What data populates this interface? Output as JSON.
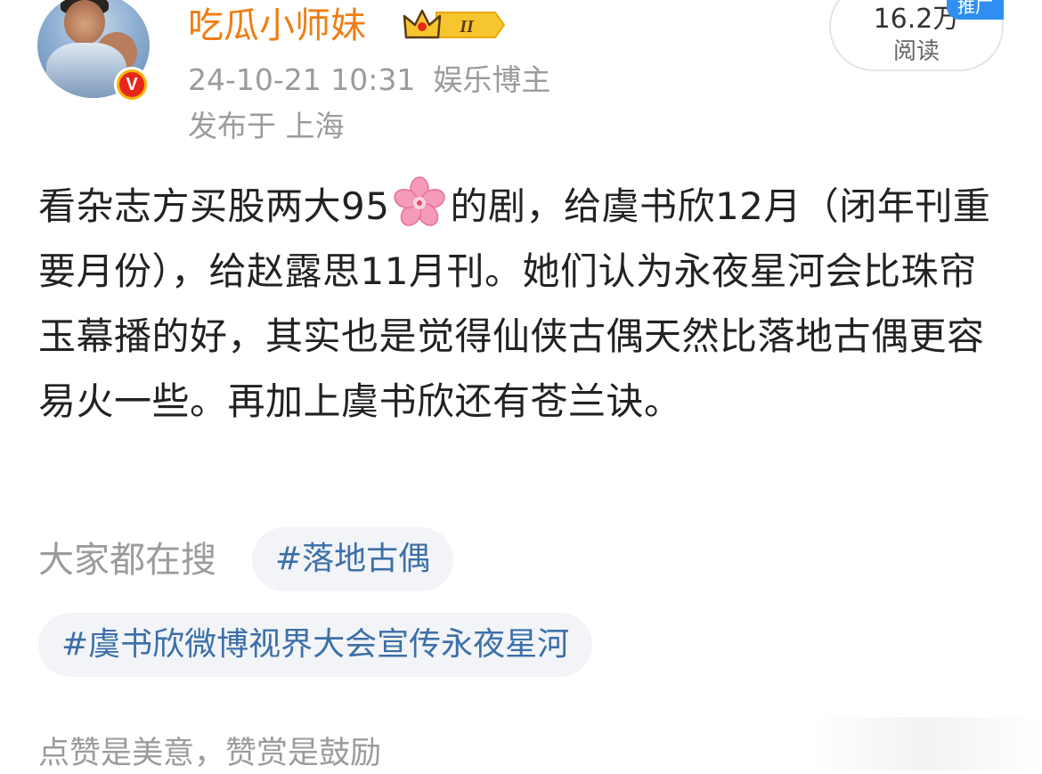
{
  "author": {
    "name": "吃瓜小师妹",
    "level_badge": "II",
    "verified_badge": "V",
    "timestamp": "24-10-21 10:31",
    "category": "娱乐博主",
    "location": "发布于 上海",
    "avatar": "avatar-icon",
    "crown": "crown-icon"
  },
  "stats": {
    "read_count": "16.2万",
    "read_label": "阅读",
    "promo_label": "推广"
  },
  "post": {
    "text_before_emoji": "看杂志方买股两大95",
    "emoji": "cherry-blossom-icon",
    "text_after_emoji": "的剧，给虞书欣12月（闭年刊重要月份），给赵露思11月刊。她们认为永夜星河会比珠帘玉幕播的好，其实也是觉得仙侠古偶天然比落地古偶更容易火一些。再加上虞书欣还有苍兰诀。"
  },
  "search": {
    "label": "大家都在搜",
    "tags": [
      "#落地古偶",
      "#虞书欣微博视界大会宣传永夜星河"
    ]
  },
  "footer": {
    "note": "点赞是美意，赞赏是鼓励"
  },
  "colors": {
    "username": "#ef7d12",
    "tag_text": "#3c6fa8",
    "tag_bg": "#f2f4f7",
    "meta": "#9b9b9b",
    "promo": "#2f8ff0"
  }
}
